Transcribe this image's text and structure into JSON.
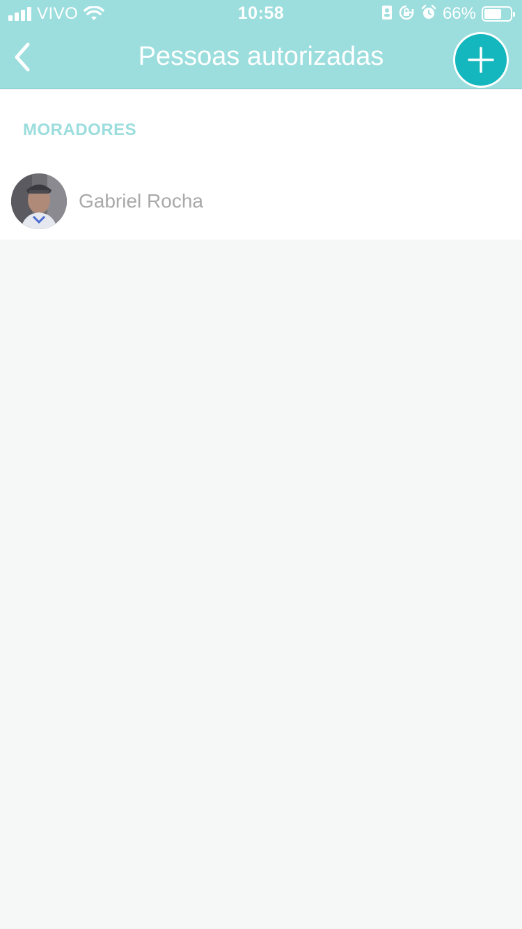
{
  "status_bar": {
    "carrier": "VIVO",
    "time": "10:58",
    "battery_pct": "66%",
    "battery_level": 0.66,
    "icons": [
      "signal-icon",
      "wifi-icon",
      "portrait-icon",
      "rotation-lock-icon",
      "alarm-icon",
      "battery-icon"
    ]
  },
  "header": {
    "title": "Pessoas autorizadas",
    "back_icon": "chevron-left-icon",
    "add_icon": "plus-icon",
    "bar_color": "#9cdddd",
    "accent_color": "#14b7bd"
  },
  "section": {
    "title": "MORADORES",
    "items": [
      {
        "name": "Gabriel Rocha",
        "avatar": "profile-photo"
      }
    ]
  }
}
